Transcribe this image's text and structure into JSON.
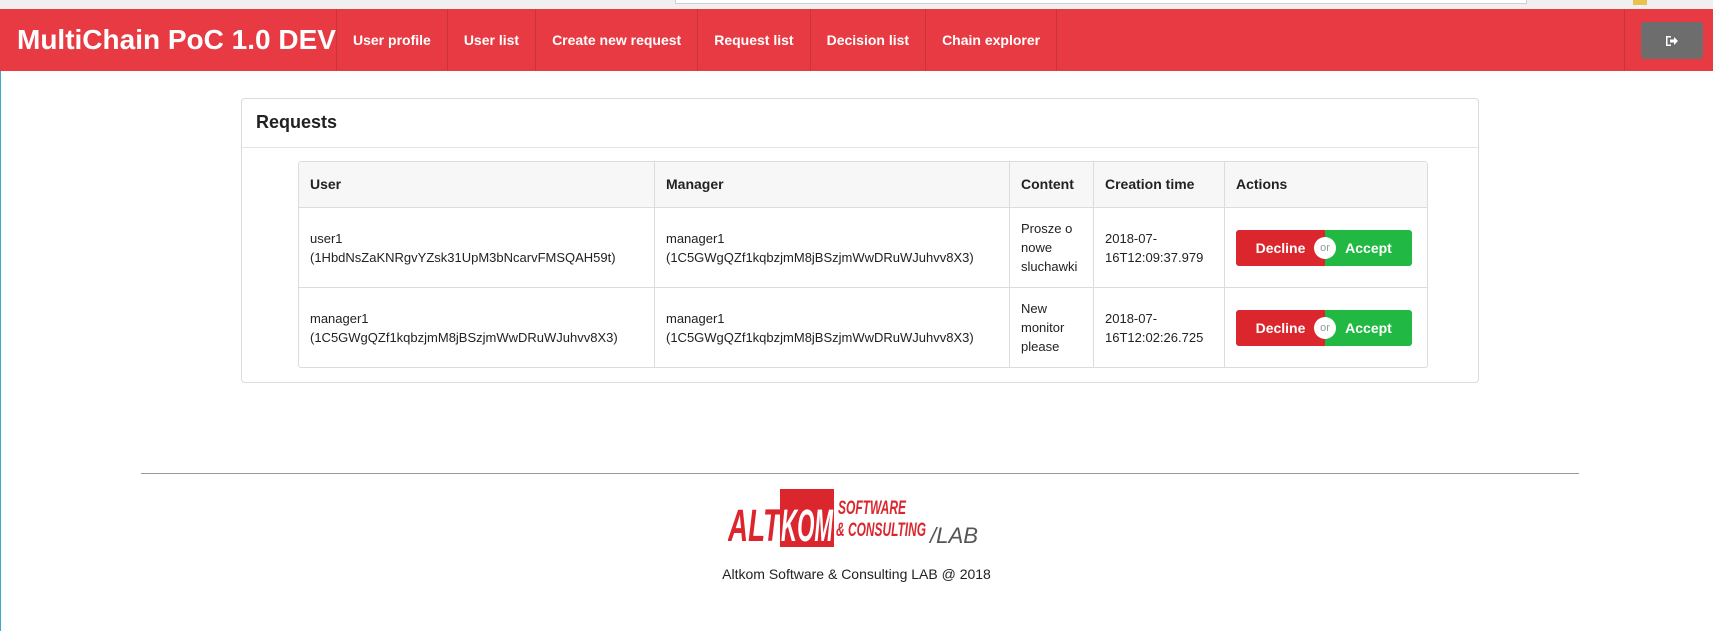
{
  "app": {
    "title": "MultiChain PoC 1.0 DEV",
    "brand_color": "#e83a43"
  },
  "nav": {
    "items": [
      {
        "label": "User profile"
      },
      {
        "label": "User list"
      },
      {
        "label": "Create new request"
      },
      {
        "label": "Request list"
      },
      {
        "label": "Decision list"
      },
      {
        "label": "Chain explorer"
      }
    ],
    "logout_icon": "sign-out-icon"
  },
  "requests": {
    "title": "Requests",
    "columns": [
      "User",
      "Manager",
      "Content",
      "Creation time",
      "Actions"
    ],
    "rows": [
      {
        "user": "user1\n(1HbdNsZaKNRgvYZsk31UpM3bNcarvFMSQAH59t)",
        "manager": "manager1\n(1C5GWgQZf1kqbzjmM8jBSzjmWwDRuWJuhvv8X3)",
        "content": "Prosze o\nnowe\nsluchawki",
        "created": "2018-07-\n16T12:09:37.979",
        "decline": "Decline",
        "or": "or",
        "accept": "Accept"
      },
      {
        "user": "manager1\n(1C5GWgQZf1kqbzjmM8jBSzjmWwDRuWJuhvv8X3)",
        "manager": "manager1\n(1C5GWgQZf1kqbzjmM8jBSzjmWwDRuWJuhvv8X3)",
        "content": "New\nmonitor\nplease",
        "created": "2018-07-\n16T12:02:26.725",
        "decline": "Decline",
        "or": "or",
        "accept": "Accept"
      }
    ],
    "decline_color": "#dc262e",
    "accept_color": "#22b844"
  },
  "footer": {
    "logo": {
      "word1": "ALT",
      "word2": "KOM",
      "line1": "SOFTWARE",
      "line2": "& CONSULTING",
      "suffix": "/LAB"
    },
    "text": "Altkom Software & Consulting LAB @ 2018"
  }
}
